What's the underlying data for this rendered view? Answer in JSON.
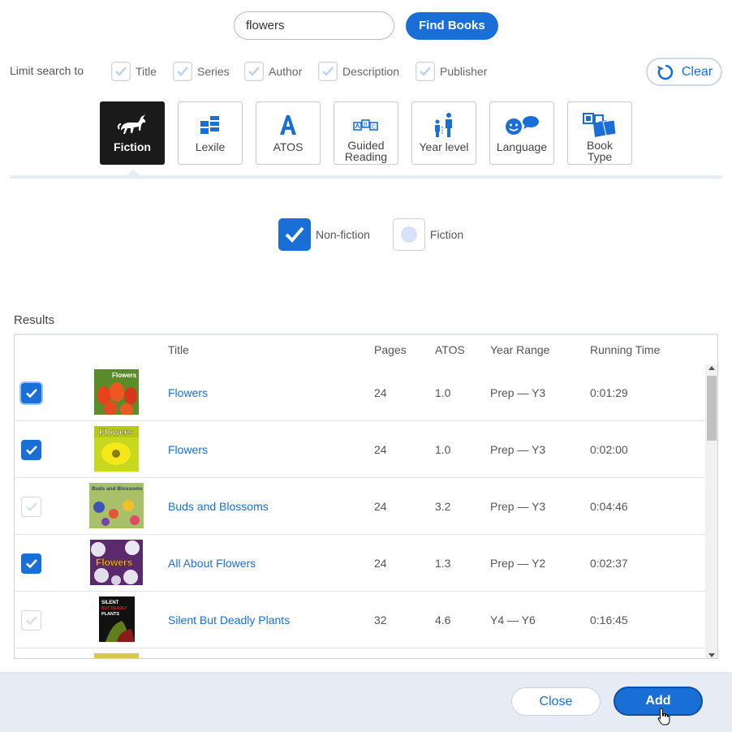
{
  "search": {
    "value": "flowers",
    "find_label": "Find Books"
  },
  "limit": {
    "label": "Limit search to",
    "options": [
      {
        "label": "Title",
        "checked": true
      },
      {
        "label": "Series",
        "checked": true
      },
      {
        "label": "Author",
        "checked": true
      },
      {
        "label": "Description",
        "checked": true
      },
      {
        "label": "Publisher",
        "checked": true
      }
    ],
    "clear_label": "Clear"
  },
  "categories": [
    {
      "label": "Fiction",
      "icon": "unicorn-icon",
      "active": true
    },
    {
      "label": "Lexile",
      "icon": "books-icon",
      "active": false
    },
    {
      "label": "ATOS",
      "icon": "letter-a-icon",
      "active": false
    },
    {
      "label": "Guided Reading",
      "line1": "Guided",
      "line2": "Reading",
      "icon": "abc-blocks-icon",
      "active": false
    },
    {
      "label": "Year level",
      "icon": "people-height-icon",
      "active": false
    },
    {
      "label": "Language",
      "icon": "speech-face-icon",
      "active": false
    },
    {
      "label": "Book Type",
      "line1": "Book",
      "line2": "Type",
      "icon": "book-stack-icon",
      "active": false
    }
  ],
  "filter": {
    "nonfiction_label": "Non-fiction",
    "nonfiction_checked": true,
    "fiction_label": "Fiction",
    "fiction_checked": false
  },
  "results": {
    "label": "Results",
    "columns": {
      "title": "Title",
      "pages": "Pages",
      "atos": "ATOS",
      "year_range": "Year Range",
      "running_time": "Running Time"
    },
    "rows": [
      {
        "checked": true,
        "title": "Flowers",
        "pages": "24",
        "atos": "1.0",
        "year_range": "Prep — Y3",
        "running_time": "0:01:29",
        "cover_text": "Flowers"
      },
      {
        "checked": true,
        "title": "Flowers",
        "pages": "24",
        "atos": "1.0",
        "year_range": "Prep — Y3",
        "running_time": "0:02:00",
        "cover_text": "Flowers"
      },
      {
        "checked": false,
        "title": "Buds and Blossoms",
        "pages": "24",
        "atos": "3.2",
        "year_range": "Prep — Y3",
        "running_time": "0:04:46",
        "cover_text": "Buds and Blossoms"
      },
      {
        "checked": true,
        "title": "All About Flowers",
        "pages": "24",
        "atos": "1.3",
        "year_range": "Prep — Y2",
        "running_time": "0:02:37",
        "cover_text": "Flowers"
      },
      {
        "checked": false,
        "title": "Silent But Deadly Plants",
        "pages": "32",
        "atos": "4.6",
        "year_range": "Y4 — Y6",
        "running_time": "0:16:45",
        "cover_text": "SILENT BUT DEADLY PLANTS"
      }
    ]
  },
  "footer": {
    "close_label": "Close",
    "add_label": "Add"
  },
  "colors": {
    "accent": "#1a6fd6",
    "footer_bg": "#e7ebf3",
    "active_tile": "#1a1a1a"
  }
}
